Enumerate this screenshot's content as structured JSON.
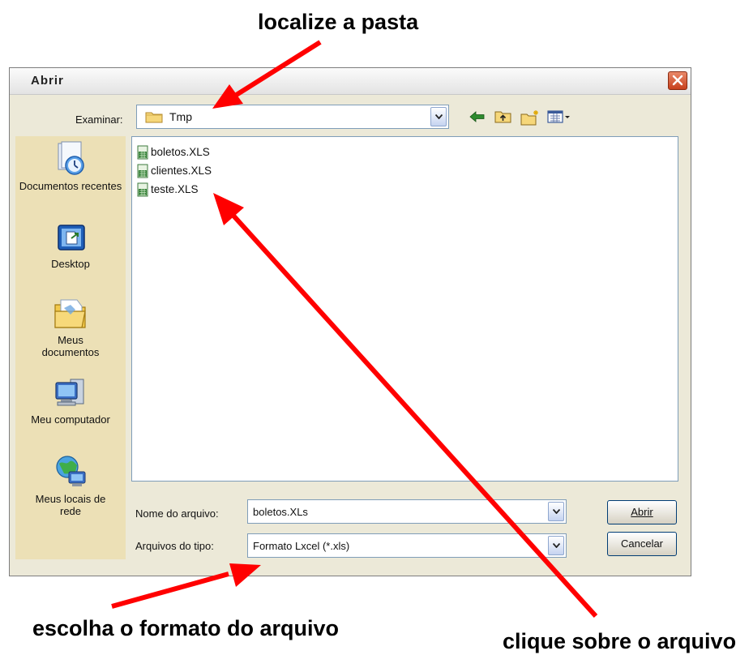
{
  "annotations": {
    "top": "localize a pasta",
    "bottom_left": "escolha o formato do arquivo",
    "bottom_right": "clique sobre o arquivo"
  },
  "dialog": {
    "title": "Abrir",
    "look_in_label": "Examinar:",
    "look_in_value": "Tmp",
    "toolbar_icons": [
      "back-arrow-icon",
      "up-folder-icon",
      "new-folder-icon",
      "views-menu-icon"
    ]
  },
  "places": [
    {
      "label": "Documentos recentes",
      "icon": "recent-documents-icon"
    },
    {
      "label": "Desktop",
      "icon": "desktop-icon"
    },
    {
      "label": "Meus documentos",
      "icon": "my-documents-icon"
    },
    {
      "label": "Meu computador",
      "icon": "my-computer-icon"
    },
    {
      "label": "Meus locais de rede",
      "icon": "network-places-icon"
    }
  ],
  "files": [
    "boletos.XLS",
    "clientes.XLS",
    "teste.XLS"
  ],
  "form": {
    "file_name_label": "Nome do arquivo:",
    "file_name_value": "boletos.XLs",
    "file_type_label": "Arquivos do tipo:",
    "file_type_value": "Formato Lxcel (*.xls)"
  },
  "buttons": {
    "open": "Abrir",
    "cancel": "Cancelar"
  },
  "colors": {
    "arrow": "#ff0000",
    "places_bar": "#ece0b6",
    "dialog_bg": "#ece9d8",
    "close_button": "#d55a35"
  }
}
